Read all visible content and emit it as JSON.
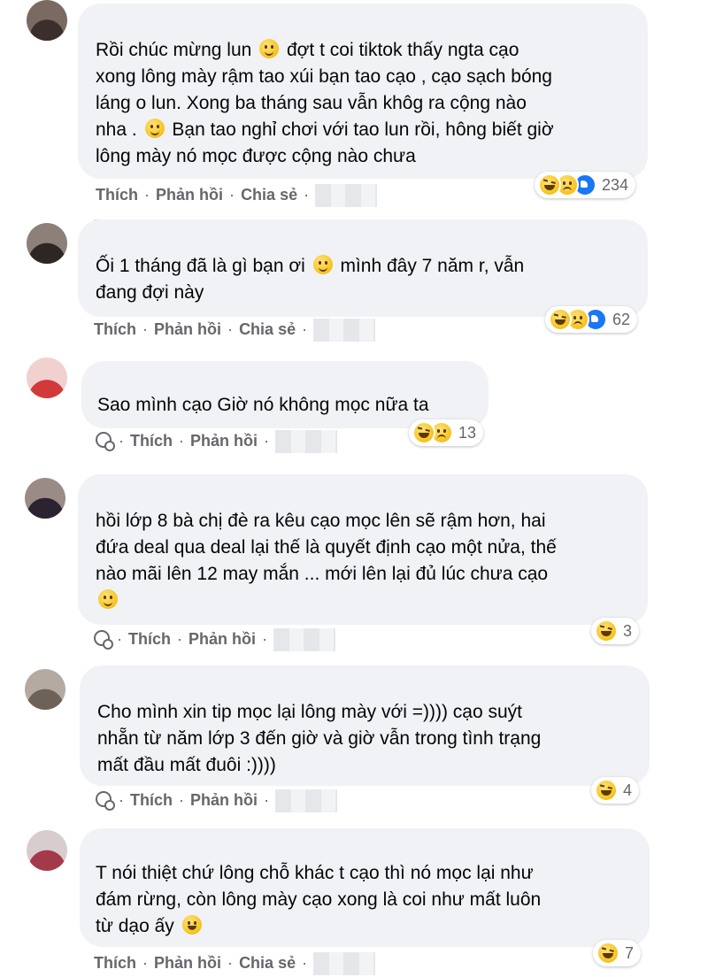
{
  "actions": {
    "like": "Thích",
    "reply": "Phản hồi",
    "share": "Chia sẻ",
    "dot": "·"
  },
  "comments": [
    {
      "lines": [
        [
          "Rồi chúc mừng lun ",
          "emoji:smile",
          " đợt t coi tiktok thấy ngta cạo"
        ],
        [
          "xong lông mày rậm tao xúi bạn tao cạo , cạo sạch bóng"
        ],
        [
          "láng o lun. Xong ba tháng sau vẫn khôg ra cộng nào"
        ],
        [
          "nha . ",
          "emoji:smile",
          " Bạn tao nghỉ chơi với tao lun rồi, hông biết giờ"
        ],
        [
          "lông mày nó mọc được cộng nào chưa"
        ]
      ],
      "reactions": [
        "haha",
        "sad",
        "like"
      ],
      "count": "234",
      "show_share": true
    },
    {
      "lines": [
        [
          "Ối 1 tháng đã là gì bạn ơi ",
          "emoji:smile",
          " mình đây 7 năm r, vẫn"
        ],
        [
          "đang đợi này"
        ]
      ],
      "reactions": [
        "haha",
        "sad",
        "like"
      ],
      "count": "62",
      "show_share": true
    },
    {
      "lines": [
        [
          "Sao mình cạo Giờ nó không mọc nữa ta"
        ]
      ],
      "reactions": [
        "haha",
        "sad"
      ],
      "count": "13",
      "show_share": false
    },
    {
      "lines": [
        [
          "hồi lớp 8 bà chị đè ra kêu cạo mọc lên sẽ rậm hơn, hai"
        ],
        [
          "đứa deal qua deal lại thế là quyết định cạo một nửa, thế"
        ],
        [
          "nào mãi lên 12 may mắn ... mới lên lại đủ lúc chưa cạo"
        ],
        [
          "emoji:smile"
        ]
      ],
      "reactions": [
        "haha"
      ],
      "count": "3",
      "show_share": false
    },
    {
      "lines": [
        [
          "Cho mình xin tip mọc lại lông mày với =)))) cạo suýt"
        ],
        [
          "nhẵn từ năm lớp 3 đến giờ và giờ vẫn trong tình trạng"
        ],
        [
          "mất đầu mất đuôi :))))"
        ]
      ],
      "reactions": [
        "haha"
      ],
      "count": "4",
      "show_share": false
    },
    {
      "lines": [
        [
          "T nói thiệt chứ lông chỗ khác t cạo thì nó mọc lại như"
        ],
        [
          "đám rừng, còn lông mày cạo xong là coi như mất luôn"
        ],
        [
          "từ dạo ấy ",
          "emoji:laugh"
        ]
      ],
      "reactions": [
        "haha"
      ],
      "count": "7",
      "show_share": true
    }
  ]
}
